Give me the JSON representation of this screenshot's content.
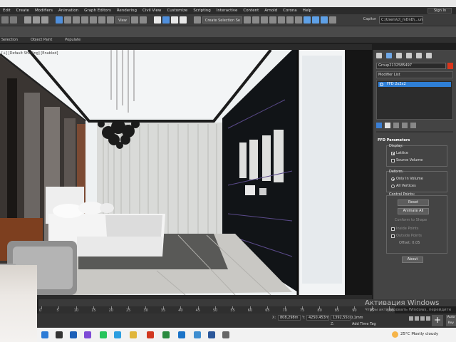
{
  "menu": [
    "Edit",
    "Create",
    "Modifiers",
    "Animation",
    "Graph Editors",
    "Rendering",
    "Civil View",
    "Customize",
    "Scripting",
    "Interactive",
    "Content",
    "Arnold",
    "Corona",
    "Help"
  ],
  "account": {
    "sign_in": "Sign In"
  },
  "toolbar": {
    "view_dropdown": "View",
    "selection_set": "Create Selection Se",
    "workspace_label": "Capitor",
    "project_path": "C:\\Users\\ct_mDnD\\...ume"
  },
  "subbar": {
    "items": [
      "Selection",
      "Object Paint",
      "Populate"
    ]
  },
  "viewport": {
    "label": "[+] [Default Shading] [Enabled]"
  },
  "command_panel": {
    "object_name": "Group2132585497",
    "object_color": "#d9361c",
    "modifier_list": "Modifier List",
    "stack_item": "FFD 2x2x2",
    "rollout_title": "FFD Parameters",
    "display": {
      "title": "Display:",
      "options": [
        {
          "label": "Lattice",
          "checked": true
        },
        {
          "label": "Source Volume",
          "checked": false
        }
      ]
    },
    "deform": {
      "title": "Deform:",
      "options": [
        {
          "label": "Only In Volume",
          "selected": true
        },
        {
          "label": "All Vertices",
          "selected": false
        }
      ]
    },
    "control_points": {
      "title": "Control Points:",
      "buttons": [
        "Reset",
        "Animate All"
      ],
      "dim_label": "Conform to Shape",
      "options": [
        "Inside Points",
        "Outside Points"
      ],
      "offset": "Offset: 0,05"
    },
    "about": "About"
  },
  "timeline": {
    "ticks": [
      "0",
      "5",
      "10",
      "15",
      "20",
      "25",
      "30",
      "35",
      "40",
      "45",
      "50",
      "55",
      "60",
      "65",
      "70",
      "75",
      "80",
      "85",
      "90",
      "95",
      "100"
    ]
  },
  "status": {
    "x_label": "X:",
    "x_value": "808,298m",
    "y_label": "Y:",
    "y_value": "4250,453m",
    "z_label": "Z:",
    "z_value": "1392,55cm",
    "grid": "Grid = 0,1mm",
    "add_time_tag": "Add Time Tag",
    "auto_key": "Auto Key"
  },
  "watermark": {
    "title": "Активация Windows",
    "subtitle": "Чтобы активировать Windows, перейдите"
  },
  "taskbar": {
    "weather_temp": "25°C",
    "weather_text": "Mostly cloudy"
  }
}
